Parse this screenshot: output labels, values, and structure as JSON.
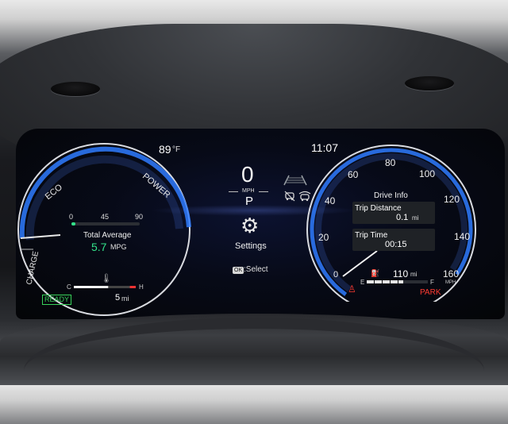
{
  "status_bar": {
    "outside_temp": "89",
    "temp_unit": "°F",
    "clock": "11:07"
  },
  "power_meter": {
    "labels": {
      "eco": "ECO",
      "power": "POWER",
      "charge": "CHARGE"
    },
    "mpg_scale": [
      "0",
      "45",
      "90"
    ],
    "total_average_label": "Total Average",
    "mpg_value": "5.7",
    "mpg_unit": "MPG",
    "temp_cold": "C",
    "temp_hot": "H",
    "ready_badge": "READY",
    "range_value": "5",
    "range_unit": "mi"
  },
  "center": {
    "speed": "0",
    "speed_unit": "MPH",
    "gear": "P",
    "menu_label": "Settings",
    "ok_key": "OK",
    "select_hint": ":Select"
  },
  "speedometer": {
    "ticks": [
      "0",
      "20",
      "40",
      "60",
      "80",
      "100",
      "120",
      "140",
      "160"
    ],
    "unit": "MPH",
    "drive_info_title": "Drive Info",
    "trip_distance_label": "Trip Distance",
    "trip_distance_value": "0.1",
    "trip_distance_unit": "mi",
    "trip_time_label": "Trip Time",
    "trip_time_value": "00:15",
    "fuel_empty": "E",
    "fuel_full": "F",
    "fuel_range_value": "110",
    "fuel_range_unit": "mi",
    "park_label": "PARK"
  },
  "colors": {
    "accent_blue": "#2f7bff",
    "mpg_green": "#33e28a",
    "ready_green": "#38d25a",
    "park_red": "#ff3b30"
  }
}
